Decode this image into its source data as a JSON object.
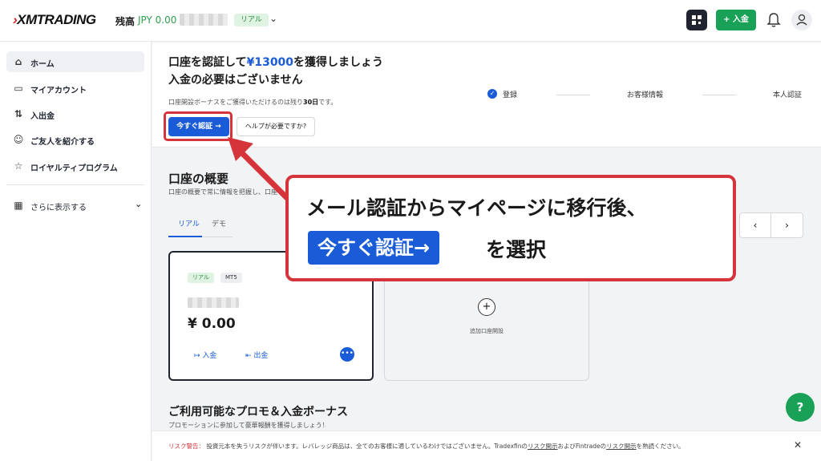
{
  "header": {
    "logo": "XMTRADING",
    "balance_label": "残高",
    "balance_value": "JPY 0.00",
    "account_type": "リアル",
    "deposit_button": "+ 入金"
  },
  "sidebar": {
    "items": [
      {
        "label": "ホーム",
        "icon": "home-icon"
      },
      {
        "label": "マイアカウント",
        "icon": "card-icon"
      },
      {
        "label": "入出金",
        "icon": "transfer-arrows-icon"
      },
      {
        "label": "ご友人を紹介する",
        "icon": "people-icon"
      },
      {
        "label": "ロイヤルティプログラム",
        "icon": "star-icon"
      }
    ],
    "more_label": "さらに表示する"
  },
  "hero": {
    "title_prefix": "口座を認証して",
    "title_amount": "¥13000",
    "title_suffix": "を獲得しましょう",
    "title_line2": "入金の必要はございません",
    "sub_prefix": "口座開設ボーナスをご獲得いただけるのは残り",
    "sub_days": "30日",
    "sub_suffix": "です。",
    "verify_button": "今すぐ認証 →",
    "help_button": "ヘルプが必要ですか?",
    "steps": [
      "登録",
      "お客様情報",
      "本人認証"
    ]
  },
  "overview": {
    "title": "口座の概要",
    "subtitle": "口座の概要で常に情報を把握し、口座",
    "tabs": [
      "リアル",
      "デモ"
    ],
    "prev": "‹",
    "next": "›"
  },
  "account_card": {
    "badges": [
      "リアル",
      "MT5"
    ],
    "balance": "¥ 0.00",
    "deposit_label": "入金",
    "withdraw_label": "出金"
  },
  "add_card": {
    "label": "追加口座開設"
  },
  "promo": {
    "title": "ご利用可能なプロモ＆入金ボーナス",
    "subtitle": "プロモーションに参加して豪華報酬を獲得しましょう！"
  },
  "risk": {
    "label": "リスク警告：",
    "text_a": "投資元本を失うリスクが伴います。レバレッジ商品は、全てのお客様に適しているわけではございません。Tradexfinの",
    "link_a": "リスク開示",
    "text_b": "およびFintradeの",
    "link_b": "リスク開示",
    "text_c": "を熟読ください。"
  },
  "callout": {
    "line1": "メール認証からマイページに移行後、",
    "highlight": "今すぐ認証→",
    "line2_rest": "を選択"
  },
  "colors": {
    "brand_blue": "#1a5bd8",
    "brand_green": "#19a157",
    "annotation_red": "#d5343a"
  }
}
